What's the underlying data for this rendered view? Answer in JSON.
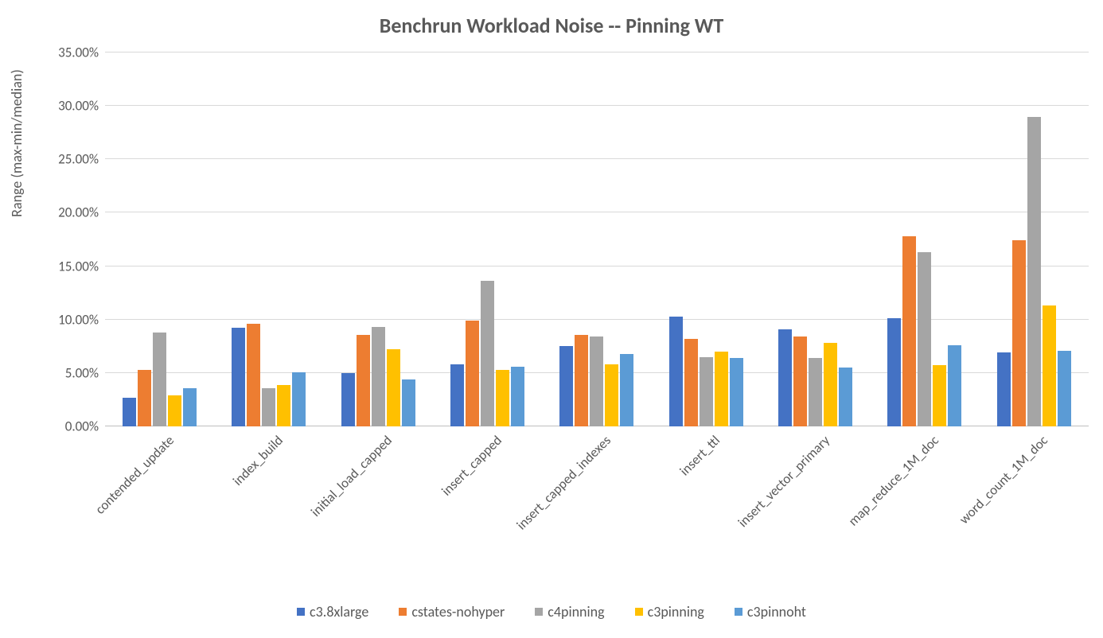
{
  "chart_data": {
    "type": "bar",
    "title": "Benchrun Workload Noise -- Pinning WT",
    "ylabel": "Range (max-min/median)",
    "xlabel": "",
    "ylim": [
      0,
      35
    ],
    "y_ticks": [
      0,
      5,
      10,
      15,
      20,
      25,
      30,
      35
    ],
    "y_tick_labels": [
      "0.00%",
      "5.00%",
      "10.00%",
      "15.00%",
      "20.00%",
      "25.00%",
      "30.00%",
      "35.00%"
    ],
    "categories": [
      "contended_update",
      "index_build",
      "initial_load_capped",
      "insert_capped",
      "insert_capped_indexes",
      "insert_ttl",
      "insert_vector_primary",
      "map_reduce_1M_doc",
      "word_count_1M_doc"
    ],
    "series": [
      {
        "name": "c3.8xlarge",
        "color": "#4472C4",
        "values": [
          2.7,
          9.2,
          5.0,
          5.8,
          7.5,
          10.3,
          9.1,
          10.1,
          6.9
        ]
      },
      {
        "name": "cstates-nohyper",
        "color": "#ED7D31",
        "values": [
          5.3,
          9.6,
          8.6,
          9.9,
          8.6,
          8.2,
          8.4,
          17.8,
          17.4
        ]
      },
      {
        "name": "c4pinning",
        "color": "#A5A5A5",
        "values": [
          8.8,
          3.6,
          9.3,
          13.6,
          8.4,
          6.5,
          6.4,
          16.3,
          29.0
        ]
      },
      {
        "name": "c3pinning",
        "color": "#FFC000",
        "values": [
          2.9,
          3.9,
          7.2,
          5.3,
          5.8,
          7.0,
          7.8,
          5.7,
          11.3
        ]
      },
      {
        "name": "c3pinnoht",
        "color": "#5B9BD5",
        "values": [
          3.6,
          5.1,
          4.4,
          5.6,
          6.8,
          6.4,
          5.5,
          7.6,
          7.1
        ]
      }
    ]
  }
}
